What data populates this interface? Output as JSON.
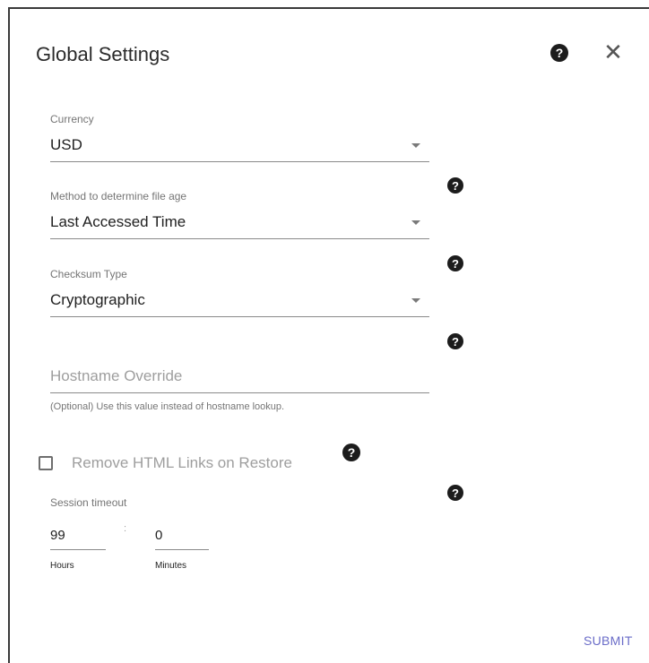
{
  "dialog": {
    "title": "Global Settings",
    "help_icon": "question-circle",
    "close_glyph": "✕"
  },
  "fields": {
    "currency": {
      "label": "Currency",
      "value": "USD"
    },
    "file_age": {
      "label": "Method to determine file age",
      "value": "Last Accessed Time"
    },
    "checksum": {
      "label": "Checksum Type",
      "value": "Cryptographic"
    },
    "hostname": {
      "placeholder": "Hostname Override",
      "hint": "(Optional) Use this value instead of hostname lookup."
    }
  },
  "remove_links": {
    "label": "Remove HTML Links on Restore",
    "checked": false
  },
  "session_timeout": {
    "label": "Session timeout",
    "hours_value": "99",
    "hours_label": "Hours",
    "separator": ":",
    "minutes_value": "0",
    "minutes_label": "Minutes"
  },
  "help_glyph": "?",
  "submit_label": "SUBMIT",
  "colors": {
    "accent": "#6a6cc8",
    "help_icon_bg": "#1c1c1c"
  }
}
